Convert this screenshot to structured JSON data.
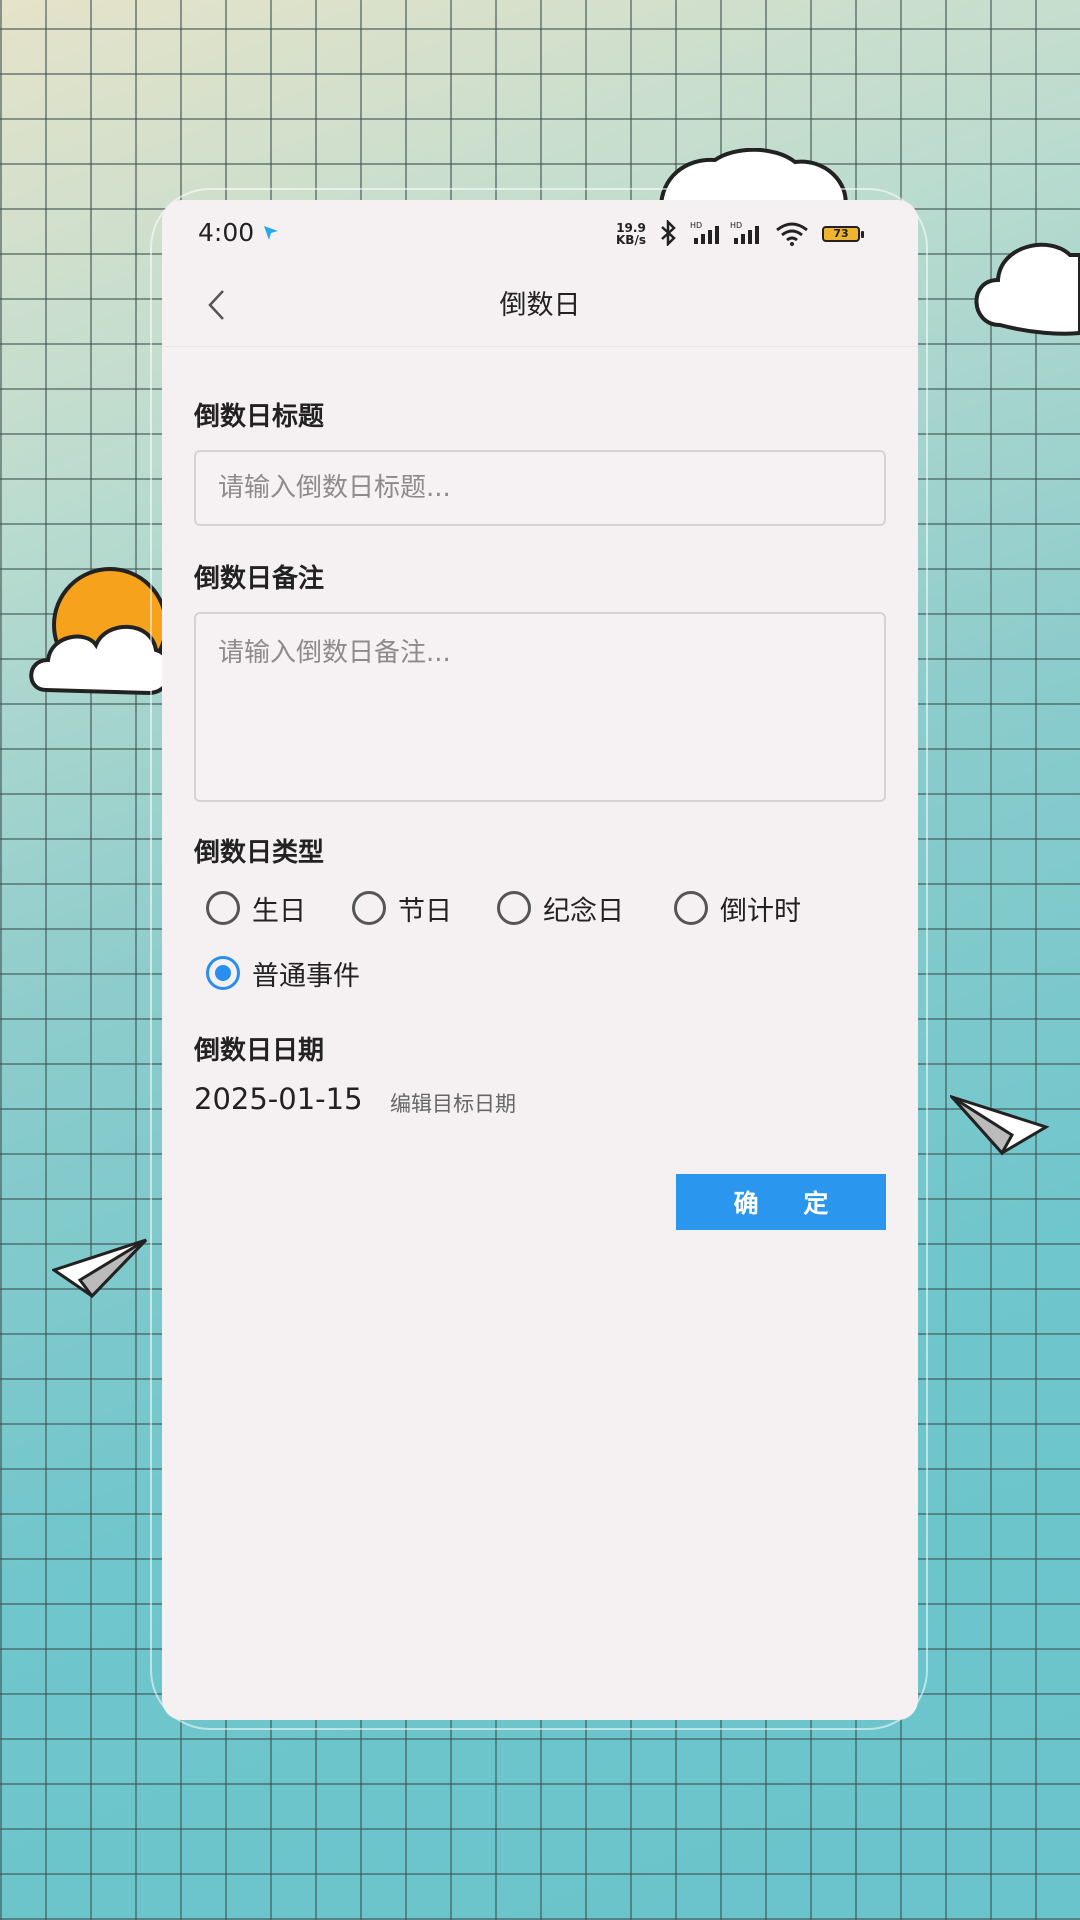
{
  "status_bar": {
    "time": "4:00",
    "net_speed_value": "19.9",
    "net_speed_unit": "KB/s",
    "battery": "73"
  },
  "header": {
    "title": "倒数日"
  },
  "form": {
    "title_label": "倒数日标题",
    "title_placeholder": "请输入倒数日标题...",
    "note_label": "倒数日备注",
    "note_placeholder": "请输入倒数日备注...",
    "type_label": "倒数日类型",
    "types": [
      {
        "label": "生日",
        "checked": false
      },
      {
        "label": "节日",
        "checked": false
      },
      {
        "label": "纪念日",
        "checked": false
      },
      {
        "label": "倒计时",
        "checked": false
      },
      {
        "label": "普通事件",
        "checked": true
      }
    ],
    "date_label": "倒数日日期",
    "date_value": "2025-01-15",
    "date_edit": "编辑目标日期",
    "confirm": "确 定"
  },
  "colors": {
    "accent": "#2a96ee",
    "radio_checked": "#2a8ef0",
    "card_bg": "#f5f0f1",
    "sun": "#f6a21c"
  }
}
